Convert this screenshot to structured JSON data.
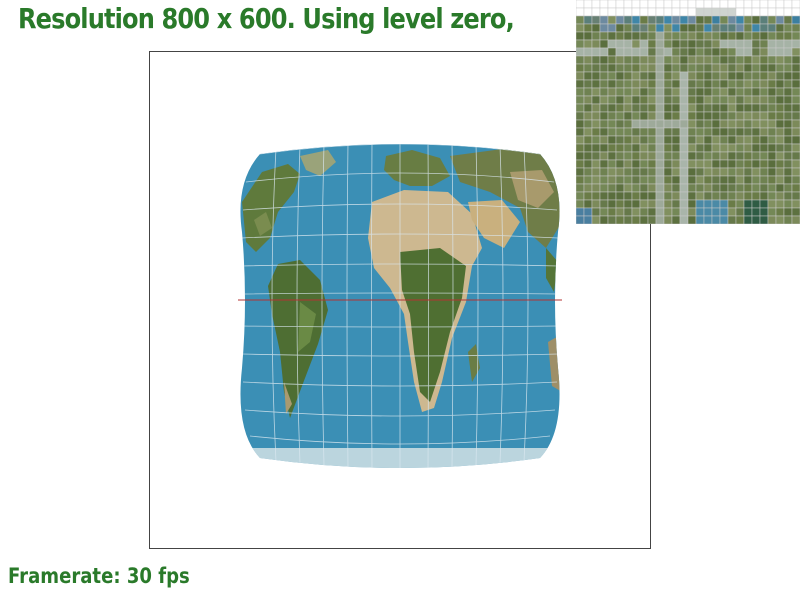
{
  "header": {
    "title": "Resolution 800 x 600. Using level zero,"
  },
  "footer": {
    "framerate": "Framerate: 30 fps"
  },
  "viewport": {
    "projection_map": "textured world map",
    "ocean_color": "#3b8fb5",
    "land_color": "#5f7a3c",
    "desert_color": "#cdb890",
    "grid_color": "#dbe8f0",
    "equator_color": "#b33333"
  },
  "zoom_inset": {
    "content": "magnified texture pixels",
    "base_color": "#6b7d4a",
    "road_color": "#a6b3a6",
    "water_color": "#3f86a8"
  }
}
